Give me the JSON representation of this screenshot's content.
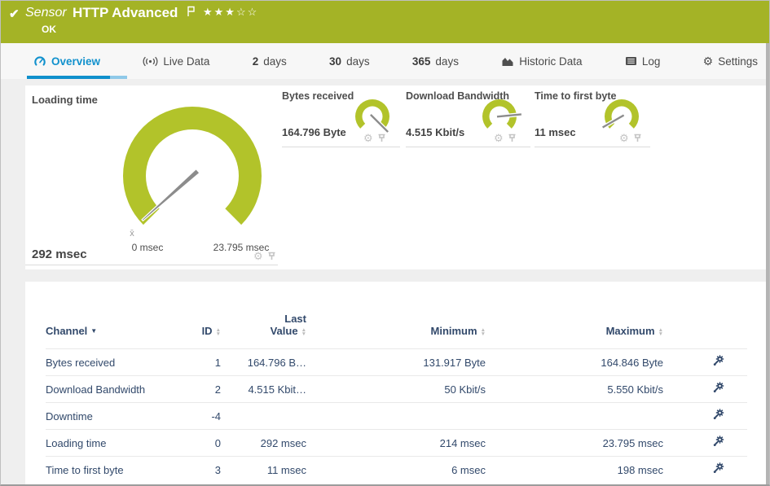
{
  "header": {
    "check_icon": "✔",
    "kind_label": "Sensor",
    "title": "HTTP Advanced",
    "status": "OK",
    "stars_filled": "★★★",
    "stars_empty": "☆☆"
  },
  "tabs": [
    {
      "label": "Overview",
      "active": true
    },
    {
      "label": "Live Data"
    },
    {
      "num": "2",
      "label": "days"
    },
    {
      "num": "30",
      "label": "days"
    },
    {
      "num": "365",
      "label": "days"
    },
    {
      "label": "Historic Data"
    },
    {
      "label": "Log"
    },
    {
      "label": "Settings"
    }
  ],
  "gauges": {
    "loading_time": {
      "title": "Loading time",
      "value": 292,
      "min": 0,
      "max": 23795,
      "value_label": "292 msec",
      "min_label": "0 msec",
      "max_label": "23.795 msec",
      "avg_marker": "x̄"
    },
    "bytes_received": {
      "title": "Bytes received",
      "value": 164796,
      "min": 0,
      "max": 164846,
      "value_label": "164.796 Byte"
    },
    "download_bandwidth": {
      "title": "Download Bandwidth",
      "value": 4515,
      "min": 0,
      "max": 5550,
      "value_label": "4.515 Kbit/s"
    },
    "time_to_first_byte": {
      "title": "Time to first byte",
      "value": 11,
      "min": 0,
      "max": 198,
      "value_label": "11 msec"
    }
  },
  "table": {
    "columns": {
      "channel": "Channel",
      "id": "ID",
      "last_line1": "Last",
      "last_line2": "Value",
      "minimum": "Minimum",
      "maximum": "Maximum"
    },
    "rows": [
      {
        "channel": "Bytes received",
        "id": "1",
        "last": "164.796 B…",
        "min": "131.917 Byte",
        "max": "164.846 Byte"
      },
      {
        "channel": "Download Bandwidth",
        "id": "2",
        "last": "4.515 Kbit…",
        "min": "50 Kbit/s",
        "max": "5.550 Kbit/s"
      },
      {
        "channel": "Downtime",
        "id": "-4",
        "last": "",
        "min": "",
        "max": ""
      },
      {
        "channel": "Loading time",
        "id": "0",
        "last": "292 msec",
        "min": "214 msec",
        "max": "23.795 msec"
      },
      {
        "channel": "Time to first byte",
        "id": "3",
        "last": "11 msec",
        "min": "6 msec",
        "max": "198 msec"
      }
    ]
  },
  "colors": {
    "header_green": "#a4b326",
    "gauge_green": "#b2c32a",
    "active_blue": "#1191cd",
    "table_navy": "#32496b",
    "status_text": "#ffffff"
  }
}
